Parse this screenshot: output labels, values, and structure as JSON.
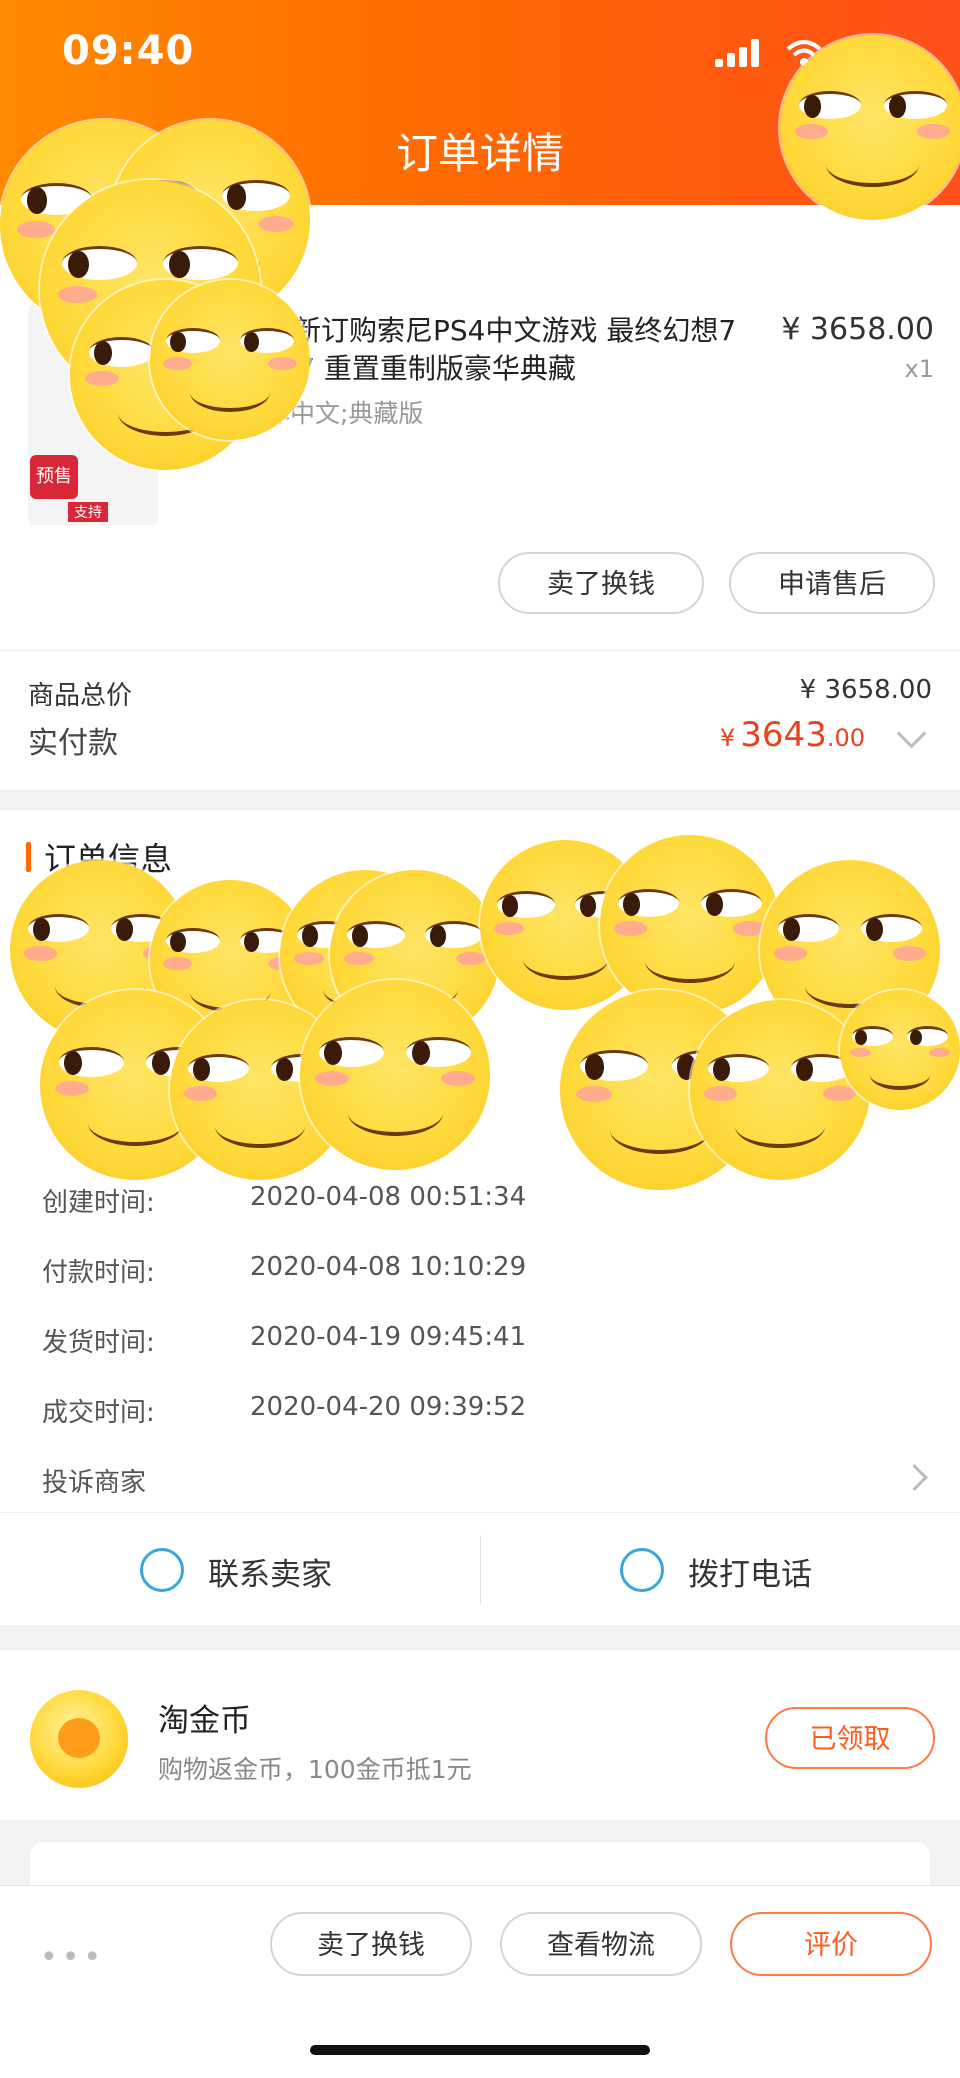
{
  "status_bar": {
    "time": "09:40"
  },
  "header": {
    "title": "订单详情"
  },
  "product": {
    "title": "全新订购索尼PS4中文游戏 最终幻想7 FF7 重置重制版豪华典藏",
    "sku": "体中文;典藏版",
    "price": "¥ 3658.00",
    "qty": "x1",
    "presale_badge": "预售",
    "badge_sub": "支持"
  },
  "product_actions": {
    "sell_label": "卖了换钱",
    "after_sale_label": "申请售后"
  },
  "totals": {
    "total_label": "商品总价",
    "total_value": "¥ 3658.00",
    "paid_label": "实付款",
    "paid_currency": "¥",
    "paid_integer": "3643",
    "paid_decimal": ".00"
  },
  "order_info": {
    "title": "订单信息",
    "rows": [
      {
        "key": "创建时间:",
        "value": "2020-04-08 00:51:34"
      },
      {
        "key": "付款时间:",
        "value": "2020-04-08 10:10:29"
      },
      {
        "key": "发货时间:",
        "value": "2020-04-19 09:45:41"
      },
      {
        "key": "成交时间:",
        "value": "2020-04-20 09:39:52"
      }
    ],
    "complaint": "投诉商家"
  },
  "contact": {
    "seller_label": "联系卖家",
    "phone_label": "拨打电话"
  },
  "coins": {
    "title": "淘金币",
    "desc": "购物返金币，100金币抵1元",
    "button": "已领取"
  },
  "bottom_bar": {
    "more": "•••",
    "sell_label": "卖了换钱",
    "logistics_label": "查看物流",
    "review_label": "评价"
  },
  "colors": {
    "accent": "#ff6a00",
    "price_orange": "#e8431b",
    "contact_blue": "#36a8d8"
  }
}
